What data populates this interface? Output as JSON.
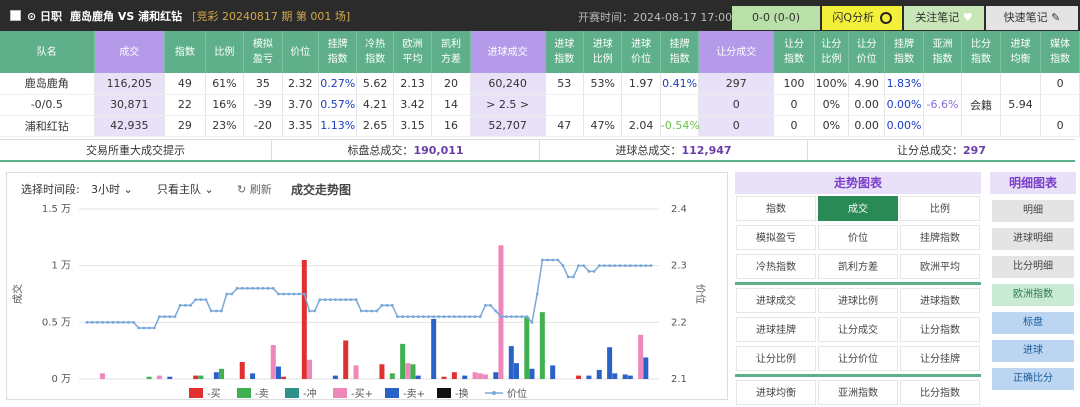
{
  "topbar": {
    "league": "⊙ 日职",
    "teams": "鹿岛鹿角  VS  浦和红钻",
    "period": "[竞彩 20240817 期 第 001 场]",
    "kickoff": "开赛时间：2024-08-17 17:00",
    "score": "0-0 (0-0)",
    "flash": "闪Q分析",
    "follow": "关注笔记",
    "quick": "快速笔记"
  },
  "table": {
    "headers": [
      "队名",
      "成交",
      "指数",
      "比例",
      "模拟\n盈亏",
      "价位",
      "挂牌\n指数",
      "冷热\n指数",
      "欧洲\n平均",
      "凯利\n方差",
      "进球成交",
      "进球\n指数",
      "进球\n比例",
      "进球\n价位",
      "挂牌\n指数",
      "让分成交",
      "让分\n指数",
      "让分\n比例",
      "让分\n价位",
      "挂牌\n指数",
      "亚洲\n指数",
      "比分\n指数",
      "进球\n均衡",
      "媒体\n指数"
    ],
    "rows": [
      [
        "鹿岛鹿角",
        "116,205",
        "49",
        "61%",
        "35",
        "2.32",
        "0.27%",
        "5.62",
        "2.13",
        "20",
        "60,240",
        "53",
        "53%",
        "1.97",
        "0.41%",
        "297",
        "100",
        "100%",
        "4.90",
        "1.83%",
        "",
        "",
        "",
        "0"
      ],
      [
        "-0/0.5",
        "30,871",
        "22",
        "16%",
        "-39",
        "3.70",
        "0.57%",
        "4.21",
        "3.42",
        "14",
        "> 2.5 >",
        "",
        "",
        "",
        "",
        "0",
        "0",
        "0%",
        "0.00",
        "0.00%",
        "-6.6%",
        "会籍",
        "5.94",
        ""
      ],
      [
        "浦和红钻",
        "42,935",
        "29",
        "23%",
        "-20",
        "3.35",
        "1.13%",
        "2.65",
        "3.15",
        "16",
        "52,707",
        "47",
        "47%",
        "2.04",
        "-0.54%",
        "0",
        "0",
        "0%",
        "0.00",
        "0.00%",
        "",
        "",
        "",
        "0"
      ]
    ]
  },
  "totals": {
    "hint": "交易所重大成交提示",
    "label1": "标盘总成交：",
    "value1": "190,011",
    "label2": "进球总成交：",
    "value2": "112,947",
    "label3": "让分总成交：",
    "value3": "297"
  },
  "chart_controls": {
    "time_label": "选择时间段:",
    "time_value": "3小时",
    "team_value": "只看主队",
    "refresh": "刷新",
    "title": "成交走势图"
  },
  "chart_data": {
    "type": "bar",
    "title": "成交走势图",
    "ylabel": "成交",
    "y2label": "价位",
    "ylim": [
      0,
      15000
    ],
    "y2lim": [
      2.1,
      2.4
    ],
    "yticks": [
      "1.5 万",
      "1 万",
      "0.5 万",
      "0 万"
    ],
    "y2ticks": [
      "2.4",
      "2.3",
      "2.2",
      "2.1"
    ],
    "legend": [
      "-买",
      "-卖",
      "-冲",
      "-买+",
      "-卖+",
      "-换",
      "价位"
    ],
    "colors": {
      "buy": "#e03030",
      "sell": "#40b050",
      "chong": "#30908a",
      "buyplus": "#ee88bb",
      "sellplus": "#2a62c8",
      "swap": "#111111",
      "price": "#7aa8d8"
    },
    "bars": [
      {
        "x": 3,
        "v": 500,
        "s": "buyplus"
      },
      {
        "x": 12,
        "v": 200,
        "s": "sell"
      },
      {
        "x": 14,
        "v": 300,
        "s": "buyplus"
      },
      {
        "x": 16,
        "v": 200,
        "s": "sellplus"
      },
      {
        "x": 21,
        "v": 300,
        "s": "buy"
      },
      {
        "x": 22,
        "v": 300,
        "s": "sell"
      },
      {
        "x": 25,
        "v": 600,
        "s": "sellplus"
      },
      {
        "x": 26,
        "v": 900,
        "s": "sell"
      },
      {
        "x": 30,
        "v": 1500,
        "s": "buy"
      },
      {
        "x": 32,
        "v": 500,
        "s": "sellplus"
      },
      {
        "x": 36,
        "v": 3000,
        "s": "buyplus"
      },
      {
        "x": 37,
        "v": 1100,
        "s": "sellplus"
      },
      {
        "x": 38,
        "v": 200,
        "s": "buy"
      },
      {
        "x": 42,
        "v": 10500,
        "s": "buy"
      },
      {
        "x": 43,
        "v": 1700,
        "s": "buyplus"
      },
      {
        "x": 48,
        "v": 300,
        "s": "sellplus"
      },
      {
        "x": 50,
        "v": 3400,
        "s": "buy"
      },
      {
        "x": 52,
        "v": 1200,
        "s": "buyplus"
      },
      {
        "x": 57,
        "v": 1300,
        "s": "buy"
      },
      {
        "x": 59,
        "v": 500,
        "s": "sell"
      },
      {
        "x": 61,
        "v": 3100,
        "s": "sell"
      },
      {
        "x": 62,
        "v": 1400,
        "s": "buyplus"
      },
      {
        "x": 63,
        "v": 1300,
        "s": "sell"
      },
      {
        "x": 64,
        "v": 300,
        "s": "sellplus"
      },
      {
        "x": 67,
        "v": 5300,
        "s": "sellplus"
      },
      {
        "x": 69,
        "v": 200,
        "s": "buy"
      },
      {
        "x": 71,
        "v": 600,
        "s": "buy"
      },
      {
        "x": 73,
        "v": 300,
        "s": "sellplus"
      },
      {
        "x": 75,
        "v": 600,
        "s": "buyplus"
      },
      {
        "x": 76,
        "v": 500,
        "s": "buyplus"
      },
      {
        "x": 77,
        "v": 400,
        "s": "buyplus"
      },
      {
        "x": 79,
        "v": 600,
        "s": "sellplus"
      },
      {
        "x": 80,
        "v": 11800,
        "s": "buyplus"
      },
      {
        "x": 82,
        "v": 2900,
        "s": "sellplus"
      },
      {
        "x": 83,
        "v": 1400,
        "s": "sellplus"
      },
      {
        "x": 85,
        "v": 5500,
        "s": "sell"
      },
      {
        "x": 86,
        "v": 900,
        "s": "sellplus"
      },
      {
        "x": 88,
        "v": 5900,
        "s": "sell"
      },
      {
        "x": 90,
        "v": 1200,
        "s": "sellplus"
      },
      {
        "x": 95,
        "v": 300,
        "s": "buy"
      },
      {
        "x": 97,
        "v": 300,
        "s": "sellplus"
      },
      {
        "x": 99,
        "v": 800,
        "s": "sellplus"
      },
      {
        "x": 101,
        "v": 2800,
        "s": "sellplus"
      },
      {
        "x": 102,
        "v": 500,
        "s": "sellplus"
      },
      {
        "x": 104,
        "v": 400,
        "s": "sellplus"
      },
      {
        "x": 105,
        "v": 300,
        "s": "sellplus"
      },
      {
        "x": 107,
        "v": 3900,
        "s": "buyplus"
      },
      {
        "x": 108,
        "v": 1900,
        "s": "sellplus"
      }
    ],
    "price": [
      2.2,
      2.2,
      2.2,
      2.2,
      2.2,
      2.2,
      2.2,
      2.2,
      2.2,
      2.2,
      2.19,
      2.19,
      2.19,
      2.19,
      2.21,
      2.21,
      2.21,
      2.21,
      2.23,
      2.23,
      2.23,
      2.24,
      2.24,
      2.24,
      2.22,
      2.22,
      2.22,
      2.25,
      2.25,
      2.26,
      2.26,
      2.26,
      2.26,
      2.26,
      2.26,
      2.26,
      2.26,
      2.25,
      2.25,
      2.25,
      2.25,
      2.25,
      2.25,
      2.22,
      2.22,
      2.24,
      2.24,
      2.24,
      2.24,
      2.24,
      2.24,
      2.24,
      2.24,
      2.22,
      2.22,
      2.22,
      2.22,
      2.23,
      2.23,
      2.23,
      2.21,
      2.21,
      2.21,
      2.21,
      2.21,
      2.21,
      2.21,
      2.21,
      2.21,
      2.21,
      2.21,
      2.21,
      2.21,
      2.21,
      2.21,
      2.21,
      2.21,
      2.23,
      2.23,
      2.22,
      2.21,
      2.21,
      2.21,
      2.21,
      2.21,
      2.21,
      2.2,
      2.25,
      2.31,
      2.31,
      2.31,
      2.31,
      2.3,
      2.28,
      2.28,
      2.3,
      2.3,
      2.29,
      2.29,
      2.3,
      2.3,
      2.3,
      2.3,
      2.3,
      2.3,
      2.3,
      2.3,
      2.3,
      2.3,
      2.3
    ],
    "n": 110
  },
  "trend": {
    "title": "走势图表",
    "row1": [
      "指数",
      "成交",
      "比例"
    ],
    "row2": [
      "模拟盈亏",
      "价位",
      "挂牌指数"
    ],
    "row3": [
      "冷热指数",
      "凯利方差",
      "欧洲平均"
    ],
    "row4": [
      "进球成交",
      "进球比例",
      "进球指数"
    ],
    "row5": [
      "进球挂牌",
      "让分成交",
      "让分指数"
    ],
    "row6": [
      "让分比例",
      "让分价位",
      "让分挂牌"
    ],
    "row7": [
      "进球均衡",
      "亚洲指数",
      "比分指数"
    ]
  },
  "detail": {
    "title": "明细图表",
    "items": [
      "明细",
      "进球明细",
      "比分明细",
      "欧洲指数",
      "标盘",
      "进球",
      "正确比分"
    ]
  }
}
